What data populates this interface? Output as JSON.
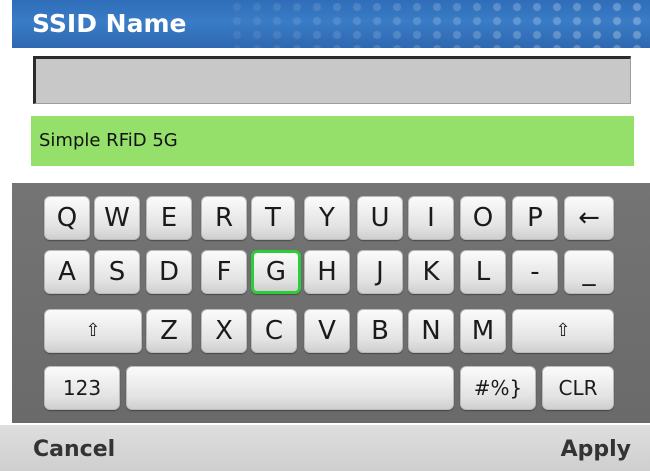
{
  "header": {
    "title": "SSID Name"
  },
  "input": {
    "value": ""
  },
  "suggestion": {
    "text": "Simple RFiD 5G"
  },
  "keyboard": {
    "row1": [
      "Q",
      "W",
      "E",
      "R",
      "T",
      "Y",
      "U",
      "I",
      "O",
      "P",
      "←"
    ],
    "row2": [
      "A",
      "S",
      "D",
      "F",
      "G",
      "H",
      "J",
      "K",
      "L",
      "-",
      "_"
    ],
    "row3": [
      "⇧",
      "Z",
      "X",
      "C",
      "V",
      "B",
      "N",
      "M",
      "⇧"
    ],
    "row4": [
      "123",
      "",
      "#%}",
      "CLR"
    ],
    "selected_key": "G",
    "colors": {
      "selected_border": "#2ccc3a",
      "background": "#6f6f6f"
    }
  },
  "footer": {
    "left_label": "Cancel",
    "right_label": "Apply"
  },
  "colors": {
    "header": "#3474c0",
    "suggestion_bg": "#94e06a"
  }
}
